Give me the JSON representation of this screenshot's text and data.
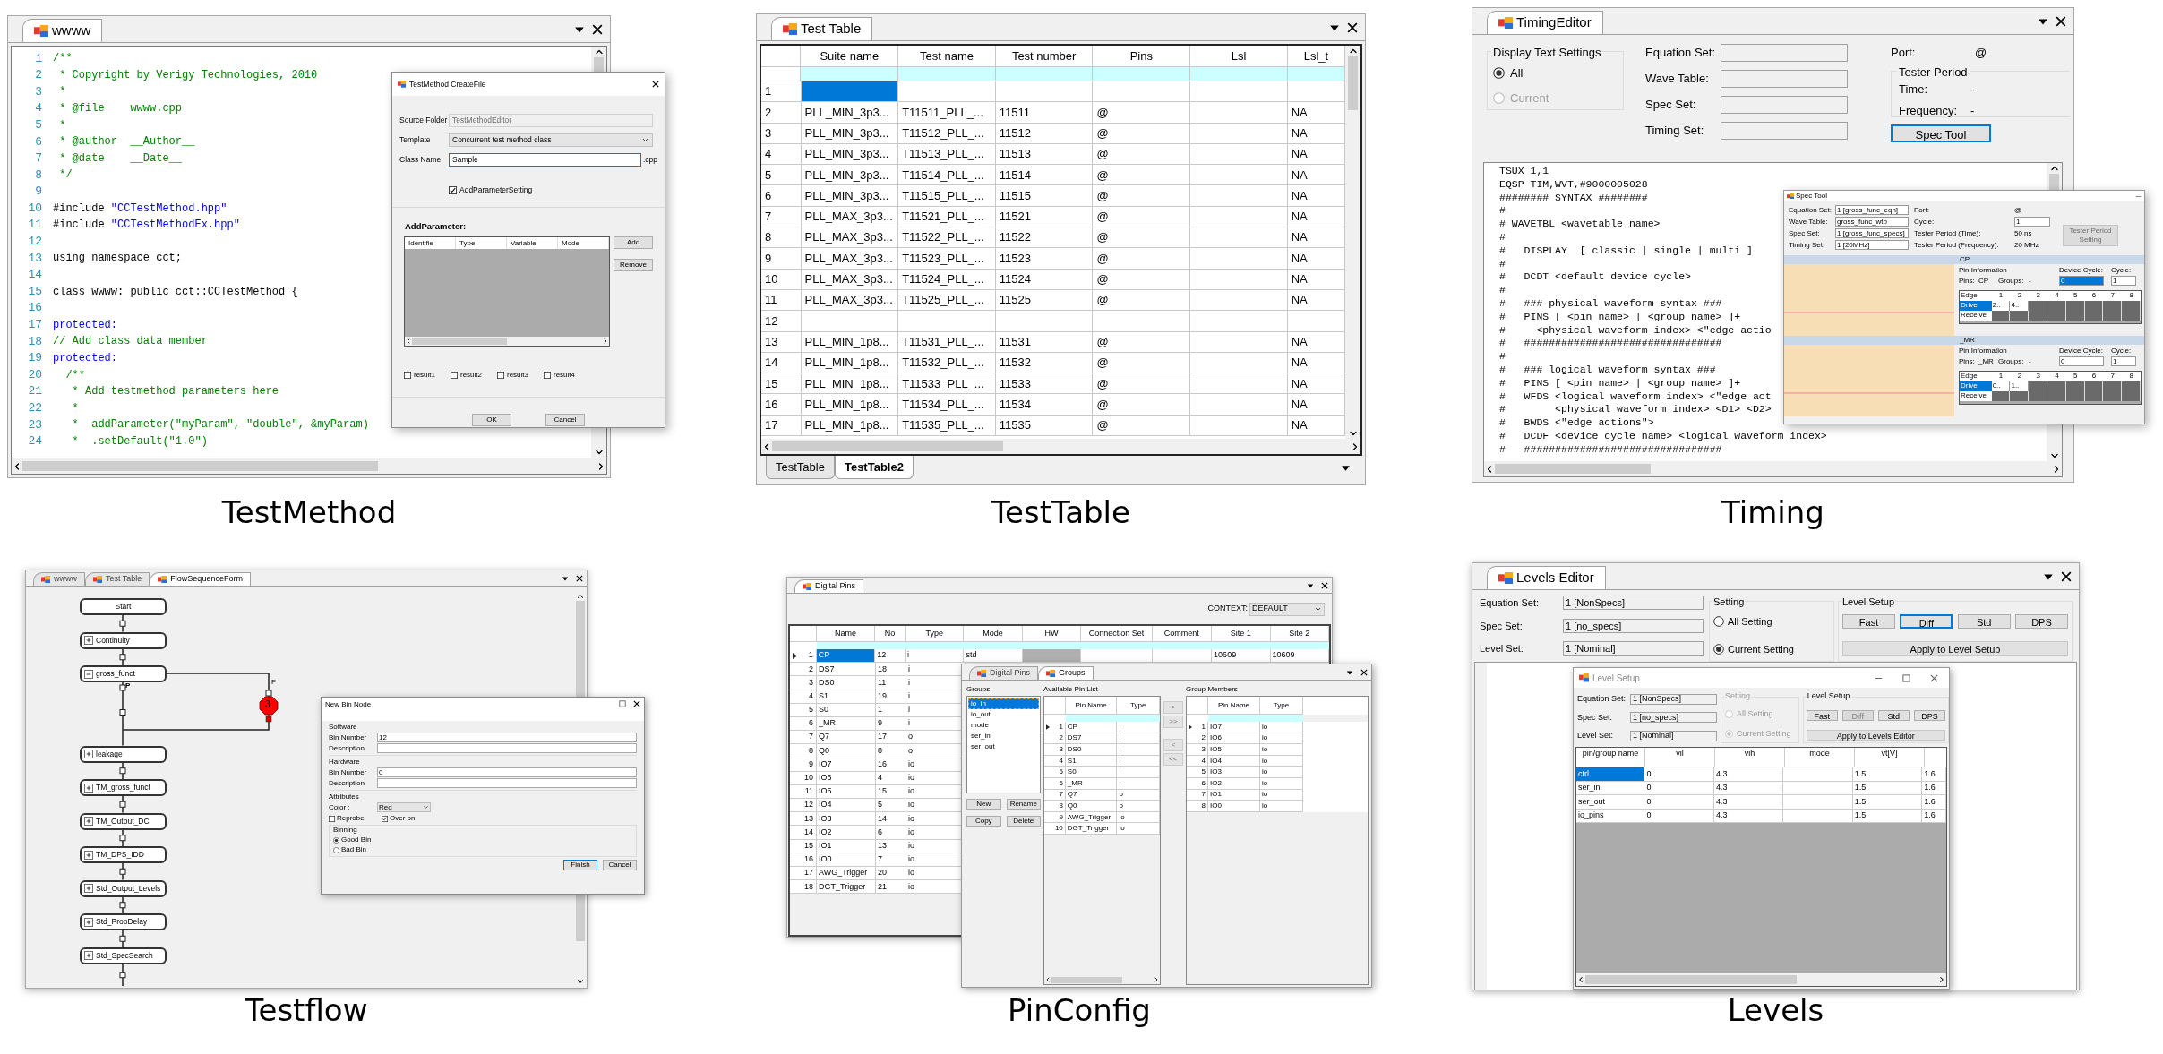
{
  "test_method": {
    "caption": "TestMethod",
    "tab": "wwww",
    "code_lines": [
      {
        "number": "1",
        "segments": [
          {
            "kind": "comment",
            "text": "/**"
          }
        ]
      },
      {
        "number": "2",
        "segments": [
          {
            "kind": "comment",
            "text": " * Copyright by Verigy Technologies, 2010"
          }
        ]
      },
      {
        "number": "3",
        "segments": [
          {
            "kind": "comment",
            "text": " *"
          }
        ]
      },
      {
        "number": "4",
        "segments": [
          {
            "kind": "comment",
            "text": " * @file    wwww.cpp"
          }
        ]
      },
      {
        "number": "5",
        "segments": [
          {
            "kind": "comment",
            "text": " *"
          }
        ]
      },
      {
        "number": "6",
        "segments": [
          {
            "kind": "comment",
            "text": " * @author  __Author__"
          }
        ]
      },
      {
        "number": "7",
        "segments": [
          {
            "kind": "comment",
            "text": " * @date    __Date__"
          }
        ]
      },
      {
        "number": "8",
        "segments": [
          {
            "kind": "comment",
            "text": " */"
          }
        ]
      },
      {
        "number": "9"
      },
      {
        "number": "10",
        "segments": [
          {
            "kind": "plain",
            "text": "#include "
          },
          {
            "kind": "string",
            "text": "\"CCTestMethod.hpp\""
          }
        ]
      },
      {
        "number": "11",
        "segments": [
          {
            "kind": "plain",
            "text": "#include "
          },
          {
            "kind": "string",
            "text": "\"CCTestMethodEx.hpp\""
          }
        ]
      },
      {
        "number": "12"
      },
      {
        "number": "13",
        "segments": [
          {
            "kind": "plain",
            "text": "using namespace cct;"
          }
        ]
      },
      {
        "number": "14"
      },
      {
        "number": "15",
        "segments": [
          {
            "kind": "plain",
            "text": "class wwww: public cct::CCTestMethod {"
          }
        ]
      },
      {
        "number": "16"
      },
      {
        "number": "17",
        "segments": [
          {
            "kind": "keyword",
            "text": "protected:"
          }
        ]
      },
      {
        "number": "18",
        "segments": [
          {
            "kind": "comment",
            "text": "// Add class data member"
          }
        ]
      },
      {
        "number": "19",
        "segments": [
          {
            "kind": "keyword",
            "text": "protected:"
          }
        ]
      },
      {
        "number": "20",
        "segments": [
          {
            "kind": "comment",
            "text": "  /**"
          }
        ]
      },
      {
        "number": "21",
        "segments": [
          {
            "kind": "comment",
            "text": "   * Add testmethod parameters here"
          }
        ]
      },
      {
        "number": "22",
        "segments": [
          {
            "kind": "comment",
            "text": "   *"
          }
        ]
      },
      {
        "number": "23",
        "segments": [
          {
            "kind": "comment",
            "text": "   *  addParameter(\"myParam\", \"double\", &myParam)"
          }
        ]
      },
      {
        "number": "24",
        "segments": [
          {
            "kind": "comment",
            "text": "   *  .setDefault(\"1.0\")"
          }
        ]
      }
    ],
    "dialog": {
      "title": "TestMethod CreateFile",
      "fields": [
        {
          "label": "Source Folder",
          "value": "TestMethodEditor",
          "kind": "readonly"
        },
        {
          "label": "Template",
          "value": "Concurrent test method class",
          "kind": "dropdown"
        },
        {
          "label": "Class Name",
          "value": "Sample",
          "kind": "text",
          "suffix": ".cpp"
        }
      ],
      "add_parameter_setting": {
        "label": "AddParameterSetting",
        "checked": true
      },
      "param_heading": "AddParameter:",
      "param_columns": [
        "Identifie",
        "Type",
        "Variable",
        "Mode"
      ],
      "side_buttons": [
        "Add",
        "Remove"
      ],
      "results": [
        {
          "label": "result1",
          "checked": false
        },
        {
          "label": "result2",
          "checked": false
        },
        {
          "label": "result3",
          "checked": false
        },
        {
          "label": "result4",
          "checked": false
        }
      ],
      "buttons": [
        "OK",
        "Cancel"
      ]
    }
  },
  "test_table": {
    "caption": "TestTable",
    "tab": "Test Table",
    "columns": [
      "Suite name",
      "Test name",
      "Test number",
      "Pins",
      "Lsl",
      "Lsl_t"
    ],
    "rows": [
      {
        "number": "1",
        "selected": true
      },
      {
        "number": "2",
        "selected": false,
        "suite_name": "PLL_MIN_3p3...",
        "test_name": "T11511_PLL_...",
        "test_number": "11511",
        "pins": "@",
        "lsl_t": "NA"
      },
      {
        "number": "3",
        "selected": false,
        "suite_name": "PLL_MIN_3p3...",
        "test_name": "T11512_PLL_...",
        "test_number": "11512",
        "pins": "@",
        "lsl_t": "NA"
      },
      {
        "number": "4",
        "selected": false,
        "suite_name": "PLL_MIN_3p3...",
        "test_name": "T11513_PLL_...",
        "test_number": "11513",
        "pins": "@",
        "lsl_t": "NA"
      },
      {
        "number": "5",
        "selected": false,
        "suite_name": "PLL_MIN_3p3...",
        "test_name": "T11514_PLL_...",
        "test_number": "11514",
        "pins": "@",
        "lsl_t": "NA"
      },
      {
        "number": "6",
        "selected": false,
        "suite_name": "PLL_MIN_3p3...",
        "test_name": "T11515_PLL_...",
        "test_number": "11515",
        "pins": "@",
        "lsl_t": "NA"
      },
      {
        "number": "7",
        "selected": false,
        "suite_name": "PLL_MAX_3p3...",
        "test_name": "T11521_PLL_...",
        "test_number": "11521",
        "pins": "@",
        "lsl_t": "NA"
      },
      {
        "number": "8",
        "selected": false,
        "suite_name": "PLL_MAX_3p3...",
        "test_name": "T11522_PLL_...",
        "test_number": "11522",
        "pins": "@",
        "lsl_t": "NA"
      },
      {
        "number": "9",
        "selected": false,
        "suite_name": "PLL_MAX_3p3...",
        "test_name": "T11523_PLL_...",
        "test_number": "11523",
        "pins": "@",
        "lsl_t": "NA"
      },
      {
        "number": "10",
        "selected": false,
        "suite_name": "PLL_MAX_3p3...",
        "test_name": "T11524_PLL_...",
        "test_number": "11524",
        "pins": "@",
        "lsl_t": "NA"
      },
      {
        "number": "11",
        "selected": false,
        "suite_name": "PLL_MAX_3p3...",
        "test_name": "T11525_PLL_...",
        "test_number": "11525",
        "pins": "@",
        "lsl_t": "NA"
      },
      {
        "number": "12",
        "selected": false
      },
      {
        "number": "13",
        "selected": false,
        "suite_name": "PLL_MIN_1p8...",
        "test_name": "T11531_PLL_...",
        "test_number": "11531",
        "pins": "@",
        "lsl_t": "NA"
      },
      {
        "number": "14",
        "selected": false,
        "suite_name": "PLL_MIN_1p8...",
        "test_name": "T11532_PLL_...",
        "test_number": "11532",
        "pins": "@",
        "lsl_t": "NA"
      },
      {
        "number": "15",
        "selected": false,
        "suite_name": "PLL_MIN_1p8...",
        "test_name": "T11533_PLL_...",
        "test_number": "11533",
        "pins": "@",
        "lsl_t": "NA"
      },
      {
        "number": "16",
        "selected": false,
        "suite_name": "PLL_MIN_1p8...",
        "test_name": "T11534_PLL_...",
        "test_number": "11534",
        "pins": "@",
        "lsl_t": "NA"
      },
      {
        "number": "17",
        "selected": false,
        "suite_name": "PLL_MIN_1p8...",
        "test_name": "T11535_PLL_...",
        "test_number": "11535",
        "pins": "@",
        "lsl_t": "NA"
      }
    ],
    "sheet_tabs": [
      {
        "label": "TestTable",
        "selected": false
      },
      {
        "label": "TestTable2",
        "selected": true
      }
    ]
  },
  "timing": {
    "caption": "Timing",
    "tab": "TimingEditor",
    "display_group": {
      "title": "Display Text Settings",
      "options": [
        {
          "label": "All",
          "selected": true,
          "disabled": false
        },
        {
          "label": "Current",
          "selected": false,
          "disabled": true
        }
      ]
    },
    "fields": [
      {
        "label": "Equation Set:"
      },
      {
        "label": "Wave Table:"
      },
      {
        "label": "Spec Set:"
      },
      {
        "label": "Timing Set:"
      }
    ],
    "port": {
      "label": "Port:",
      "value": "@"
    },
    "tester_period": {
      "title": "Tester Period",
      "rows": [
        {
          "label": "Time:",
          "value": "-"
        },
        {
          "label": "Frequency:",
          "value": "-"
        }
      ]
    },
    "spec_tool_button": "Spec Tool",
    "code_lines": [
      "TSUX 1,1",
      "EQSP TIM,WVT,#9000005028",
      "######## SYNTAX ########",
      "#",
      "# WAVETBL <wavetable name>",
      "#",
      "#   DISPLAY  [ classic | single | multi ]",
      "#",
      "#   DCDT <default device cycle>",
      "#",
      "#   ### physical waveform syntax ###",
      "#   PINS [ <pin name> | <group name> ]+",
      "#     <physical waveform index> <\"edge actio",
      "#   ################################",
      "#",
      "#   ### logical waveform syntax ###",
      "#   PINS [ <pin name> | <group name> ]+",
      "#   WFDS <logical waveform index> <\"edge act",
      "#        <physical waveform index> <D1> <D2>",
      "#   BWDS <\"edge actions\">",
      "#   DCDF <device cycle name> <logical waveform index>",
      "#   ################################"
    ],
    "spec_tool": {
      "title": "Spec Tool",
      "fields": [
        {
          "label": "Equation Set:",
          "value": "1 [gross_func_eqn]"
        },
        {
          "label": "Wave Table:",
          "value": "gross_func_wtb"
        },
        {
          "label": "Spec Set:",
          "value": "1 [gross_func_specs]"
        },
        {
          "label": "Timing Set:",
          "value": "1 [20MHz]"
        }
      ],
      "info": [
        {
          "label": "Port:",
          "value": "@",
          "kind": "text"
        },
        {
          "label": "Cycle:",
          "value": "1",
          "kind": "spinner"
        },
        {
          "label": "Tester Period (Time):",
          "value": "50 ns",
          "kind": "text"
        },
        {
          "label": "Tester Period (Frequency):",
          "value": "20 MHz",
          "kind": "text"
        }
      ],
      "period_button": "Tester Period Setting",
      "pins": [
        {
          "name": "CP",
          "info_title": "Pin Information",
          "pins_label": "Pins:",
          "pins_value": "CP",
          "groups_label": "Groups:",
          "groups_value": "-",
          "device_cycle_label": "Device Cycle:",
          "device_cycle": "0",
          "focused": true,
          "cycle_label": "Cycle:",
          "cycle": "1",
          "edge_label": "Edge",
          "edges": [
            "1",
            "2",
            "3",
            "4",
            "5",
            "6",
            "7",
            "8"
          ],
          "drive_label": "Drive",
          "receive_label": "Receive",
          "drive_values": [
            "2..",
            "4.."
          ]
        },
        {
          "name": "_MR",
          "info_title": "Pin Information",
          "pins_label": "Pins:",
          "pins_value": "_MR",
          "groups_label": "Groups:",
          "groups_value": "-",
          "device_cycle_label": "Device Cycle:",
          "device_cycle": "0",
          "focused": false,
          "cycle_label": "Cycle:",
          "cycle": "1",
          "edge_label": "Edge",
          "edges": [
            "1",
            "2",
            "3",
            "4",
            "5",
            "6",
            "7",
            "8"
          ],
          "drive_label": "Drive",
          "receive_label": "Receive",
          "drive_values": [
            "0..",
            "1.."
          ]
        }
      ]
    }
  },
  "testflow": {
    "caption": "Testflow",
    "tabs": [
      {
        "label": "wwww",
        "selected": false
      },
      {
        "label": "Test Table",
        "selected": false
      },
      {
        "label": "FlowSequenceForm",
        "selected": true
      }
    ],
    "nodes": [
      {
        "label": "Start",
        "kind": "start"
      },
      {
        "label": "Continuity",
        "kind": "suite",
        "expanded": false
      },
      {
        "label": "gross_funct",
        "kind": "suite",
        "expanded": true
      },
      {
        "label": "leakage",
        "kind": "suite",
        "expanded": false
      },
      {
        "label": "TM_gross_funct",
        "kind": "suite",
        "expanded": false
      },
      {
        "label": "TM_Output_DC",
        "kind": "suite",
        "expanded": false
      },
      {
        "label": "TM_DPS_IDD",
        "kind": "suite",
        "expanded": false
      },
      {
        "label": "Std_Output_Levels",
        "kind": "suite",
        "expanded": false
      },
      {
        "label": "Std_PropDelay",
        "kind": "suite",
        "expanded": false
      },
      {
        "label": "Std_SpecSearch",
        "kind": "suite",
        "expanded": false
      }
    ],
    "pass_label": "P",
    "fail_label": "F",
    "bin": {
      "label": "3",
      "color": "#ff0000"
    },
    "dialog": {
      "title": "New Bin Node",
      "sections": [
        {
          "title": "Software",
          "rows": [
            {
              "label": "Bin Number",
              "value": "12"
            },
            {
              "label": "Description"
            }
          ]
        },
        {
          "title": "Hardware",
          "rows": [
            {
              "label": "Bin Number",
              "value": "0"
            },
            {
              "label": "Description"
            }
          ]
        }
      ],
      "attributes": {
        "title": "Attributes",
        "color_label": "Color :",
        "color_value": "Red",
        "checks": [
          {
            "label": "Reprobe",
            "checked": false
          },
          {
            "label": "Over on",
            "checked": true
          }
        ]
      },
      "binning": {
        "title": "Binning",
        "options": [
          {
            "label": "Good Bin",
            "selected": true
          },
          {
            "label": "Bad Bin",
            "selected": false
          }
        ]
      },
      "buttons": [
        "Finish",
        "Cancel"
      ]
    }
  },
  "pin_config": {
    "caption": "PinConfig",
    "tab": "Digital Pins",
    "context_label": "CONTEXT:",
    "context_value": "DEFAULT",
    "columns": [
      "Name",
      "No",
      "Type",
      "Mode",
      "HW",
      "Connection Set",
      "Comment",
      "Site 1",
      "Site 2"
    ],
    "rows": [
      {
        "number": "1",
        "name": "CP",
        "no": "12",
        "type": "i",
        "mode": "std",
        "site_1": "10609",
        "site_2": "10609",
        "selected": true
      },
      {
        "number": "2",
        "name": "DS7",
        "no": "18",
        "type": "i",
        "selected": false
      },
      {
        "number": "3",
        "name": "DS0",
        "no": "11",
        "type": "i",
        "selected": false
      },
      {
        "number": "4",
        "name": "S1",
        "no": "19",
        "type": "i",
        "selected": false
      },
      {
        "number": "5",
        "name": "S0",
        "no": "1",
        "type": "i",
        "selected": false
      },
      {
        "number": "6",
        "name": "_MR",
        "no": "9",
        "type": "i",
        "selected": false
      },
      {
        "number": "7",
        "name": "Q7",
        "no": "17",
        "type": "o",
        "selected": false
      },
      {
        "number": "8",
        "name": "Q0",
        "no": "8",
        "type": "o",
        "selected": false
      },
      {
        "number": "9",
        "name": "IO7",
        "no": "16",
        "type": "io",
        "selected": false
      },
      {
        "number": "10",
        "name": "IO6",
        "no": "4",
        "type": "io",
        "selected": false
      },
      {
        "number": "11",
        "name": "IO5",
        "no": "15",
        "type": "io",
        "selected": false
      },
      {
        "number": "12",
        "name": "IO4",
        "no": "5",
        "type": "io",
        "selected": false
      },
      {
        "number": "13",
        "name": "IO3",
        "no": "14",
        "type": "io",
        "selected": false
      },
      {
        "number": "14",
        "name": "IO2",
        "no": "6",
        "type": "io",
        "selected": false
      },
      {
        "number": "15",
        "name": "IO1",
        "no": "13",
        "type": "io",
        "selected": false
      },
      {
        "number": "16",
        "name": "IO0",
        "no": "7",
        "type": "io",
        "selected": false
      },
      {
        "number": "17",
        "name": "AWG_Trigger",
        "no": "20",
        "type": "io",
        "selected": false
      },
      {
        "number": "18",
        "name": "DGT_Trigger",
        "no": "21",
        "type": "io",
        "selected": false
      }
    ],
    "groups_window": {
      "tabs": [
        {
          "label": "Digital Pins",
          "selected": false
        },
        {
          "label": "Groups",
          "selected": true
        }
      ],
      "groups_label": "Groups",
      "groups": [
        {
          "label": "io_in",
          "selected": true
        },
        {
          "label": "io_out",
          "selected": false
        },
        {
          "label": "mode",
          "selected": false
        },
        {
          "label": "ser_in",
          "selected": false
        },
        {
          "label": "ser_out",
          "selected": false
        }
      ],
      "group_buttons": [
        "New",
        "Rename",
        "Copy",
        "Delete"
      ],
      "available_label": "Available Pin List",
      "pin_columns": [
        "Pin Name",
        "Type"
      ],
      "available": [
        {
          "number": "1",
          "name": "CP",
          "type": "i"
        },
        {
          "number": "2",
          "name": "DS7",
          "type": "i"
        },
        {
          "number": "3",
          "name": "DS0",
          "type": "i"
        },
        {
          "number": "4",
          "name": "S1",
          "type": "i"
        },
        {
          "number": "5",
          "name": "S0",
          "type": "i"
        },
        {
          "number": "6",
          "name": "_MR",
          "type": "i"
        },
        {
          "number": "7",
          "name": "Q7",
          "type": "o"
        },
        {
          "number": "8",
          "name": "Q0",
          "type": "o"
        },
        {
          "number": "9",
          "name": "AWG_Trigger",
          "type": "io"
        },
        {
          "number": "10",
          "name": "DGT_Trigger",
          "type": "io"
        }
      ],
      "arrow_buttons": [
        ">",
        ">>",
        "<",
        "<<"
      ],
      "members_label": "Group Members",
      "member_columns": [
        "Pin Name",
        "Type"
      ],
      "members": [
        {
          "number": "1",
          "name": "IO7",
          "type": "io"
        },
        {
          "number": "2",
          "name": "IO6",
          "type": "io"
        },
        {
          "number": "3",
          "name": "IO5",
          "type": "io"
        },
        {
          "number": "4",
          "name": "IO4",
          "type": "io"
        },
        {
          "number": "5",
          "name": "IO3",
          "type": "io"
        },
        {
          "number": "6",
          "name": "IO2",
          "type": "io"
        },
        {
          "number": "7",
          "name": "IO1",
          "type": "io"
        },
        {
          "number": "8",
          "name": "IO0",
          "type": "io"
        }
      ]
    }
  },
  "levels": {
    "caption": "Levels",
    "tab": "Levels Editor",
    "fields": [
      {
        "label": "Equation Set:",
        "value": "1 [NonSpecs]"
      },
      {
        "label": "Spec Set:",
        "value": "1 [no_specs]"
      },
      {
        "label": "Level Set:",
        "value": "1 [Nominal]"
      }
    ],
    "setting": {
      "title": "Setting",
      "disabled": false,
      "options": [
        {
          "label": "All Setting",
          "selected": false
        },
        {
          "label": "Current Setting",
          "selected": true
        }
      ]
    },
    "level_setup": {
      "title": "Level Setup",
      "buttons": [
        {
          "label": "Fast",
          "selected": false,
          "disabled": false
        },
        {
          "label": "Diff",
          "selected": true,
          "disabled": false
        },
        {
          "label": "Std",
          "selected": false,
          "disabled": false
        },
        {
          "label": "DPS",
          "selected": false,
          "disabled": false
        }
      ],
      "apply": "Apply to Level Setup"
    },
    "dialog": {
      "title": "Level Setup",
      "fields": [
        {
          "label": "Equation Set:",
          "value": "1 [NonSpecs]"
        },
        {
          "label": "Spec Set:",
          "value": "1 [no_specs]"
        },
        {
          "label": "Level Set:",
          "value": "1 [Nominal]"
        }
      ],
      "setting": {
        "title": "Setting",
        "disabled": true,
        "options": [
          {
            "label": "All Setting",
            "selected": false
          },
          {
            "label": "Current Setting",
            "selected": true
          }
        ]
      },
      "level_setup": {
        "title": "Level Setup",
        "buttons": [
          {
            "label": "Fast",
            "selected": false,
            "disabled": false
          },
          {
            "label": "Diff",
            "selected": false,
            "disabled": true
          },
          {
            "label": "Std",
            "selected": false,
            "disabled": false
          },
          {
            "label": "DPS",
            "selected": false,
            "disabled": false
          }
        ],
        "apply": "Apply to Levels Editor"
      },
      "columns": [
        "pin/group name",
        "vil",
        "vih",
        "mode",
        "vt[V]"
      ],
      "rows": [
        {
          "name": "ctrl",
          "selected": true,
          "vil": "0",
          "vih": "4.3",
          "vt": "1.5",
          "column_6": "1.6"
        },
        {
          "name": "ser_in",
          "selected": false,
          "vil": "0",
          "vih": "4.3",
          "vt": "1.5",
          "column_6": "1.6"
        },
        {
          "name": "ser_out",
          "selected": false,
          "vil": "0",
          "vih": "4.3",
          "vt": "1.5",
          "column_6": "1.6"
        },
        {
          "name": "io_pins",
          "selected": false,
          "vil": "0",
          "vih": "4.3",
          "vt": "1.5",
          "column_6": "1.6"
        }
      ]
    }
  }
}
